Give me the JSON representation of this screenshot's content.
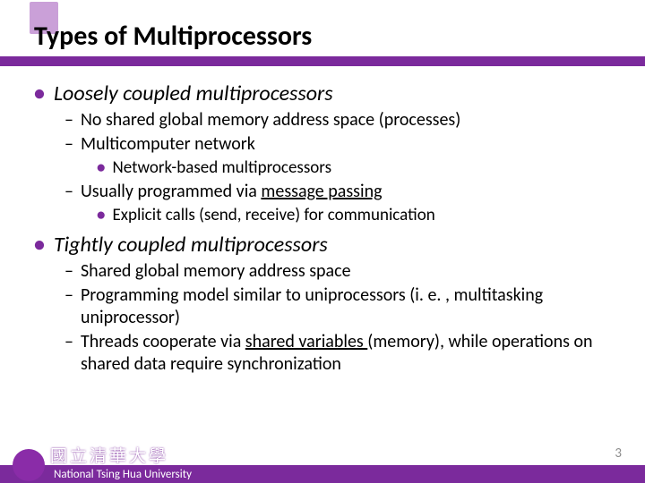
{
  "title": "Types of Multiprocessors",
  "bullets": {
    "l1a": "Loosely coupled multiprocessors",
    "l2a": "No shared global memory address space (processes)",
    "l2b": "Multicomputer network",
    "l3a": "Network-based multiprocessors",
    "l2c_pre": "Usually programmed via ",
    "l2c_u": "message passing",
    "l3b": "Explicit calls (send, receive) for communication",
    "l1b": "Tightly coupled multiprocessors",
    "l2d": "Shared global memory address space",
    "l2e": "Programming model similar to uniprocessors (i. e. , multitasking uniprocessor)",
    "l2f_pre": "Threads cooperate via ",
    "l2f_u": "shared variables ",
    "l2f_post": "(memory), while operations on shared data require synchronization"
  },
  "footer": {
    "university": "National Tsing Hua University",
    "calligraphy": "國立清華大學"
  },
  "page": "3"
}
